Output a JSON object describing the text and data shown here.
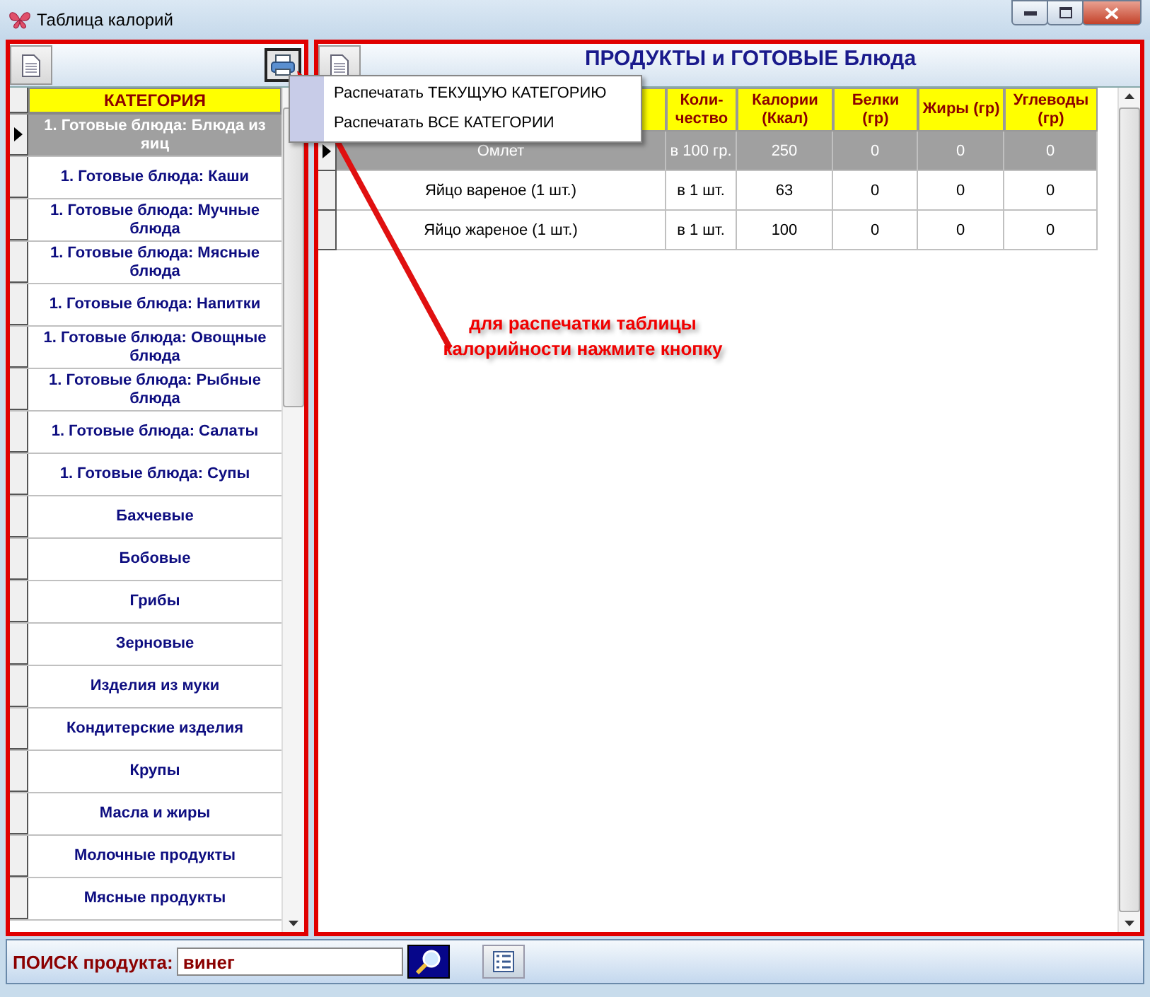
{
  "window": {
    "title": "Таблица калорий"
  },
  "categories": {
    "header": "КАТЕГОРИЯ",
    "items": [
      {
        "label": "1. Готовые блюда: Блюда из яиц",
        "selected": true
      },
      {
        "label": "1. Готовые блюда: Каши",
        "selected": false
      },
      {
        "label": "1. Готовые блюда: Мучные блюда",
        "selected": false
      },
      {
        "label": "1. Готовые блюда: Мясные блюда",
        "selected": false
      },
      {
        "label": "1. Готовые блюда: Напитки",
        "selected": false
      },
      {
        "label": "1. Готовые блюда: Овощные блюда",
        "selected": false
      },
      {
        "label": "1. Готовые блюда: Рыбные блюда",
        "selected": false
      },
      {
        "label": "1. Готовые блюда: Салаты",
        "selected": false
      },
      {
        "label": "1. Готовые блюда: Супы",
        "selected": false
      },
      {
        "label": "Бахчевые",
        "selected": false
      },
      {
        "label": "Бобовые",
        "selected": false
      },
      {
        "label": "Грибы",
        "selected": false
      },
      {
        "label": "Зерновые",
        "selected": false
      },
      {
        "label": "Изделия из муки",
        "selected": false
      },
      {
        "label": "Кондитерские изделия",
        "selected": false
      },
      {
        "label": "Крупы",
        "selected": false
      },
      {
        "label": "Масла и жиры",
        "selected": false
      },
      {
        "label": "Молочные продукты",
        "selected": false
      },
      {
        "label": "Мясные продукты",
        "selected": false
      }
    ]
  },
  "print_menu": {
    "items": [
      "Распечатать ТЕКУЩУЮ КАТЕГОРИЮ",
      "Распечатать ВСЕ КАТЕГОРИИ"
    ]
  },
  "products": {
    "title": "ПРОДУКТЫ и ГОТОВЫЕ Блюда",
    "columns": [
      "",
      "Коли-чество",
      "Калории (Ккал)",
      "Белки (гр)",
      "Жиры (гр)",
      "Углеводы (гр)"
    ],
    "rows": [
      {
        "cells": [
          "Омлет",
          "в 100 гр.",
          "250",
          "0",
          "0",
          "0"
        ],
        "selected": true
      },
      {
        "cells": [
          "Яйцо вареное (1 шт.)",
          "в 1 шт.",
          "63",
          "0",
          "0",
          "0"
        ],
        "selected": false
      },
      {
        "cells": [
          "Яйцо жареное (1 шт.)",
          "в 1 шт.",
          "100",
          "0",
          "0",
          "0"
        ],
        "selected": false
      }
    ]
  },
  "annotation": "для распечатки таблицы калорийности нажмите кнопку",
  "search": {
    "label": "ПОИСК продукта:",
    "value": "винег"
  }
}
